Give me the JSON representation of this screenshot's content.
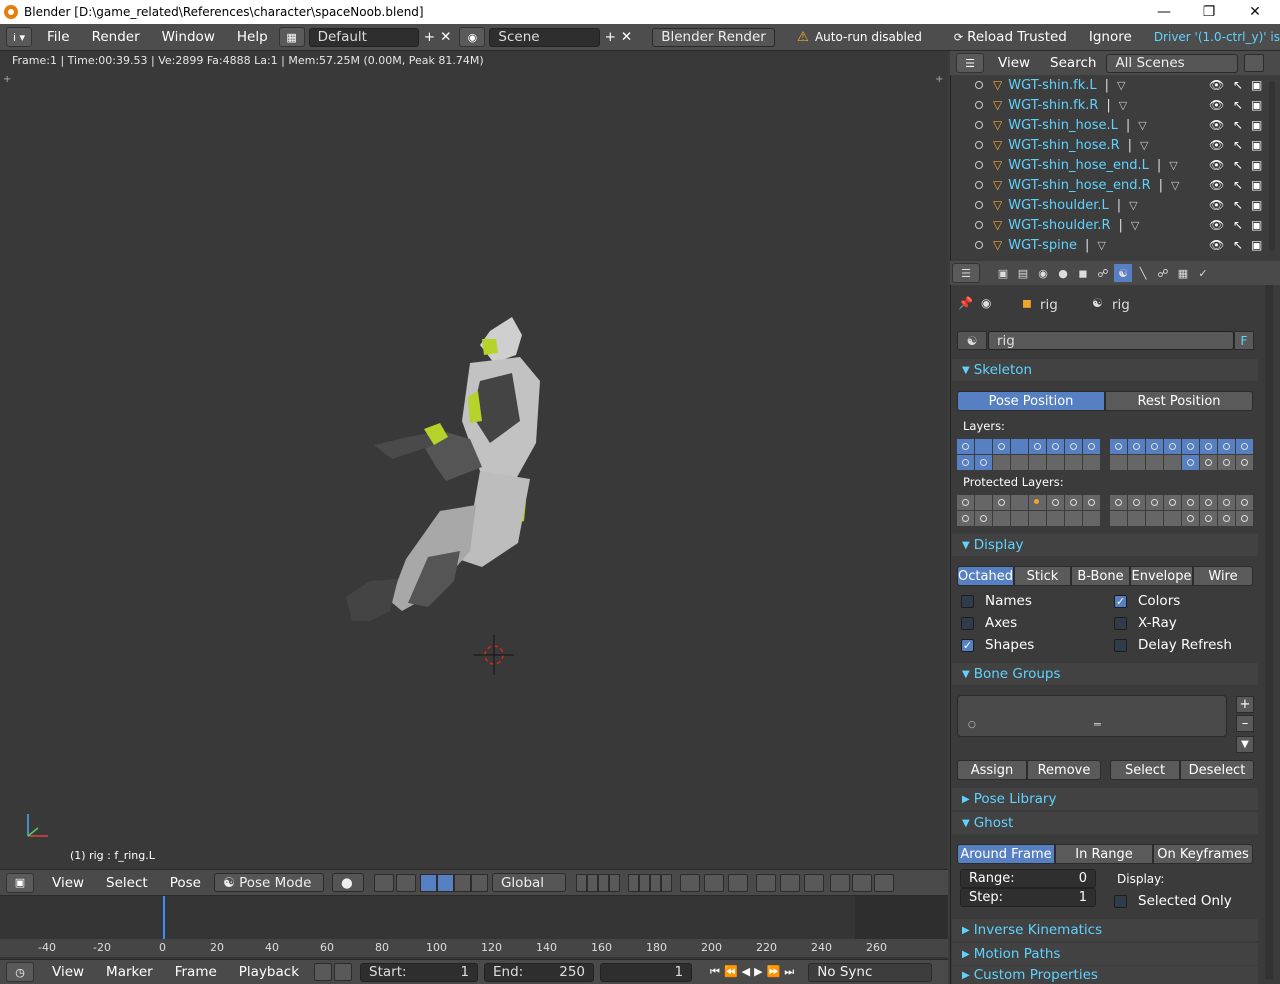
{
  "window": {
    "title": "Blender [D:\\game_related\\References\\character\\spaceNoob.blend]"
  },
  "top_menu": {
    "items": [
      "File",
      "Render",
      "Window",
      "Help"
    ],
    "screen_layout": "Default",
    "scene": "Scene",
    "render_engine": "Blender Render",
    "warning": "Auto-run disabled",
    "reload_trusted": "Reload Trusted",
    "ignore": "Ignore",
    "driver_text": "Driver '(1.0-ctrl_y)' is"
  },
  "viewport": {
    "info": "Frame:1 | Time:00:39.53 | Ve:2899 Fa:4888 La:1 | Mem:57.25M (0.00M, Peak 81.74M)",
    "active_object": "(1) rig : f_ring.L",
    "header": {
      "items": [
        "View",
        "Select",
        "Pose"
      ],
      "mode": "Pose Mode",
      "orientation": "Global"
    }
  },
  "outliner": {
    "header": {
      "view": "View",
      "search": "Search",
      "scenes": "All Scenes"
    },
    "rows": [
      "WGT-shin.fk.L",
      "WGT-shin.fk.R",
      "WGT-shin_hose.L",
      "WGT-shin_hose.R",
      "WGT-shin_hose_end.L",
      "WGT-shin_hose_end.R",
      "WGT-shoulder.L",
      "WGT-shoulder.R",
      "WGT-spine"
    ]
  },
  "properties": {
    "context_object": "rig",
    "context_data": "rig",
    "data_name": "rig",
    "data_flag": "F",
    "skeleton": {
      "title": "Skeleton",
      "pose_position": "Pose Position",
      "rest_position": "Rest Position",
      "layers_label": "Layers:",
      "protected_label": "Protected Layers:"
    },
    "display": {
      "title": "Display",
      "types": [
        "Octahed",
        "Stick",
        "B-Bone",
        "Envelope",
        "Wire"
      ],
      "names": "Names",
      "axes": "Axes",
      "shapes": "Shapes",
      "colors": "Colors",
      "xray": "X-Ray",
      "delay_refresh": "Delay Refresh"
    },
    "bone_groups": {
      "title": "Bone Groups",
      "buttons": [
        "Assign",
        "Remove",
        "Select",
        "Deselect"
      ]
    },
    "pose_library": "Pose Library",
    "ghost": {
      "title": "Ghost",
      "modes": [
        "Around Frame",
        "In Range",
        "On Keyframes"
      ],
      "range_label": "Range:",
      "range_value": "0",
      "step_label": "Step:",
      "step_value": "1",
      "display_label": "Display:",
      "selected_only": "Selected Only"
    },
    "collapsed_panels": [
      "Inverse Kinematics",
      "Motion Paths",
      "Custom Properties"
    ]
  },
  "timeline": {
    "ticks": [
      "-40",
      "-20",
      "0",
      "20",
      "40",
      "60",
      "80",
      "100",
      "120",
      "140",
      "160",
      "180",
      "200",
      "220",
      "240",
      "260"
    ],
    "header_items": [
      "View",
      "Marker",
      "Frame",
      "Playback"
    ],
    "start_label": "Start:",
    "start_value": "1",
    "end_label": "End:",
    "end_value": "250",
    "current_frame": "1",
    "sync": "No Sync"
  },
  "colors": {
    "accent_blue": "#5680c2",
    "outliner_text": "#5fd3ff",
    "warning": "#f0a52e"
  }
}
